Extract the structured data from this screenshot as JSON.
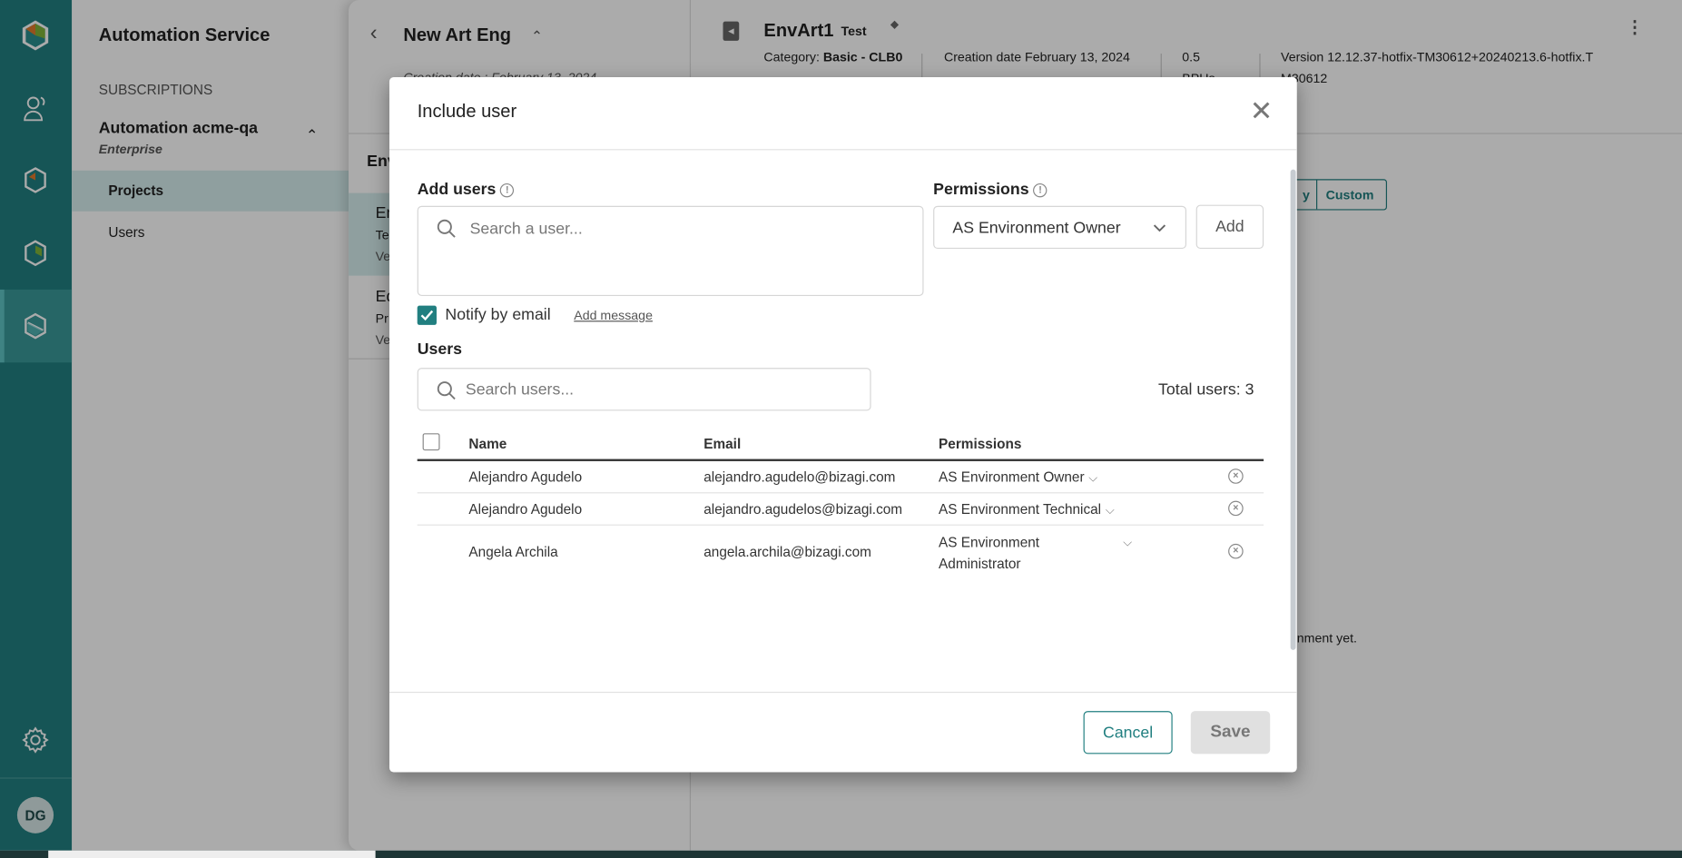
{
  "rail": {
    "icons": [
      "app-logo-icon",
      "users-admin-icon",
      "cube-orange-icon",
      "cube-green-icon",
      "cube-teal-icon",
      "gear-icon"
    ],
    "avatar": "DG",
    "brand_colors": {
      "teal": "#217f80",
      "orange": "#e07a2c",
      "green": "#7fb33a"
    }
  },
  "nav": {
    "title": "Automation Service",
    "section": "SUBSCRIPTIONS",
    "subscription": "Automation acme-qa",
    "plan": "Enterprise",
    "items": [
      {
        "label": "Projects",
        "selected": true
      },
      {
        "label": "Users",
        "selected": false
      }
    ]
  },
  "project": {
    "title": "New Art Eng",
    "creation": "Creation date : February 13, 2024",
    "list_header": "Env",
    "items": [
      {
        "l1": "En",
        "l2": "Te",
        "l3": "Ve"
      },
      {
        "l1": "Ed",
        "l2": "Pr",
        "l3": "Ve"
      }
    ]
  },
  "environment": {
    "name": "EnvArt1",
    "tag": "Test",
    "category_label": "Category:",
    "category_value": "Basic - CLB0",
    "creation": "Creation date February 13, 2024",
    "bpus": "0.5 BPUs",
    "version": "Version 12.12.37-hotfix-TM30612+20240213.6-hotfix.TM30612",
    "seg_left": "y",
    "seg_right": "Custom",
    "empty_text": "nment yet."
  },
  "modal": {
    "title": "Include user",
    "add_users_label": "Add users",
    "add_users_placeholder": "Search a user...",
    "permissions_label": "Permissions",
    "permission_selected": "AS Environment Owner",
    "add_button": "Add",
    "notify_label": "Notify by email",
    "notify_checked": true,
    "add_message": "Add message",
    "users_label": "Users",
    "search_users_placeholder": "Search users...",
    "total_users": "Total users: 3",
    "columns": [
      "Name",
      "Email",
      "Permissions"
    ],
    "rows": [
      {
        "name": "Alejandro Agudelo",
        "email": "alejandro.agudelo@bizagi.com",
        "permission": "AS Environment Owner"
      },
      {
        "name": "Alejandro Agudelo",
        "email": "alejandro.agudelos@bizagi.com",
        "permission": "AS Environment Technical"
      },
      {
        "name": "Angela Archila",
        "email": "angela.archila@bizagi.com",
        "permission_l1": "AS Environment",
        "permission_l2": "Administrator"
      }
    ],
    "cancel": "Cancel",
    "save": "Save"
  }
}
